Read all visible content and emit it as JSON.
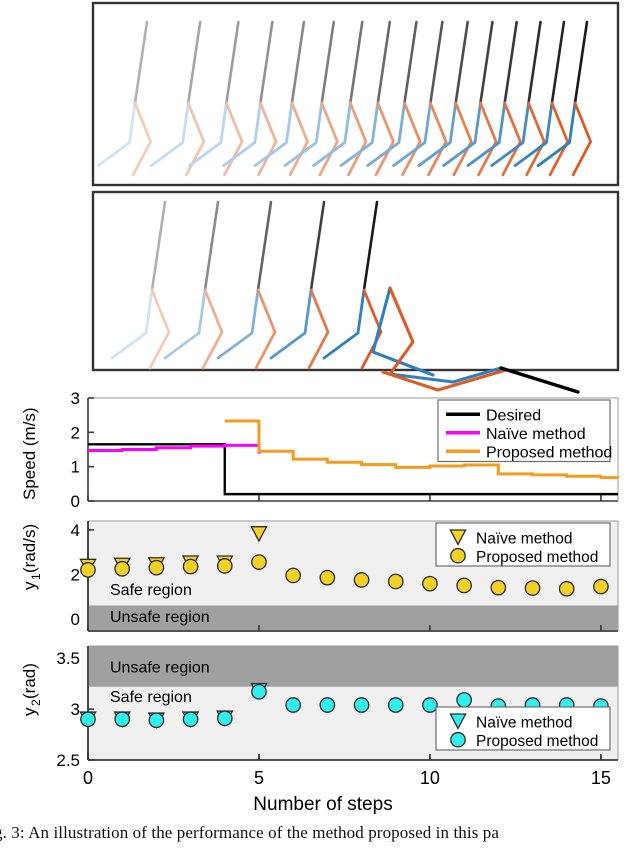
{
  "figure": {
    "caption": "g. 3: An illustration of the performance of the method proposed in this pa",
    "colors": {
      "desired": "#000000",
      "naive": "#ff00ff",
      "proposed": "#f59b1e",
      "y1_marker": "#f2d024",
      "y2_marker": "#2ff0ef",
      "safe_region": "#f0f0f0",
      "unsafe_region": "#a0a0a0",
      "leg_blue": "#2f7fc1",
      "leg_orange": "#de5c22",
      "torso": "#1a1a1a"
    }
  },
  "panels": {
    "top_walk": {
      "name": "Proposed method gait animation",
      "n_figures": 16,
      "outcome": "walks successfully"
    },
    "bottom_walk": {
      "name": "Naive method gait animation",
      "n_figures": 6,
      "outcome": "falls after 5 steps"
    }
  },
  "chart_data": [
    {
      "id": "speed",
      "type": "line",
      "title": "",
      "xlabel": "",
      "ylabel": "Speed (m/s)",
      "xlim": [
        0,
        15.5
      ],
      "ylim": [
        0,
        3
      ],
      "yticks": [
        0,
        1,
        2,
        3
      ],
      "ytick_labels": [
        "0",
        "1",
        "2",
        "3"
      ],
      "xticks": [
        0,
        5,
        10,
        15
      ],
      "grid": false,
      "legend_position": "top-right",
      "legend": [
        "Desired",
        "Naïve method",
        "Proposed method"
      ],
      "series": [
        {
          "name": "Desired",
          "color": "#000000",
          "style": "stairs",
          "x": [
            0,
            1,
            2,
            3,
            4,
            4,
            5,
            6,
            7,
            8,
            9,
            10,
            11,
            12,
            13,
            14,
            15,
            15.5
          ],
          "values": [
            1.65,
            1.65,
            1.65,
            1.65,
            1.65,
            0.2,
            0.2,
            0.2,
            0.2,
            0.2,
            0.2,
            0.2,
            0.2,
            0.2,
            0.2,
            0.2,
            0.2,
            0.2
          ]
        },
        {
          "name": "Naïve method",
          "color": "#ff00ff",
          "style": "stairs",
          "x": [
            0,
            1,
            2,
            3,
            4,
            5
          ],
          "values": [
            1.47,
            1.5,
            1.55,
            1.6,
            1.62,
            1.38
          ]
        },
        {
          "name": "Proposed method",
          "color": "#f59b1e",
          "style": "stairs",
          "x": [
            4,
            5,
            6,
            7,
            8,
            9,
            10,
            11,
            12,
            13,
            14,
            15,
            15.5
          ],
          "values": [
            2.33,
            1.45,
            1.22,
            1.13,
            1.06,
            0.98,
            1.02,
            1.05,
            0.79,
            0.76,
            0.72,
            0.68,
            0.67
          ]
        }
      ]
    },
    {
      "id": "y1",
      "type": "scatter",
      "title": "",
      "xlabel": "",
      "ylabel": "y1 (rad/s)",
      "ylabel_base": "y",
      "ylabel_sub": "1",
      "ylabel_unit": " (rad/s)",
      "xlim": [
        0,
        15.5
      ],
      "ylim": [
        -0.55,
        4.4
      ],
      "yticks": [
        0,
        2,
        4
      ],
      "ytick_labels": [
        "0",
        "2",
        "4"
      ],
      "xticks": [
        0,
        5,
        10,
        15
      ],
      "grid": false,
      "legend_position": "top-right",
      "legend": [
        "Naïve method",
        "Proposed method"
      ],
      "regions": [
        {
          "label": "Safe region",
          "from": 0.6,
          "to": 4.4,
          "color": "#f0f0f0"
        },
        {
          "label": "Unsafe region",
          "from": -0.55,
          "to": 0.6,
          "color": "#a0a0a0"
        }
      ],
      "series": [
        {
          "name": "Naïve method",
          "color": "#f2d024",
          "marker": "triangle-down",
          "x": [
            0,
            1,
            2,
            3,
            4,
            5
          ],
          "values": [
            2.35,
            2.4,
            2.42,
            2.5,
            2.5,
            3.82
          ]
        },
        {
          "name": "Proposed method",
          "color": "#f2d024",
          "marker": "circle",
          "x": [
            0,
            1,
            2,
            3,
            4,
            5,
            6,
            7,
            8,
            9,
            10,
            11,
            12,
            13,
            14,
            15
          ],
          "values": [
            2.2,
            2.25,
            2.3,
            2.35,
            2.38,
            2.55,
            1.95,
            1.85,
            1.75,
            1.68,
            1.58,
            1.5,
            1.4,
            1.38,
            1.35,
            1.45
          ]
        }
      ]
    },
    {
      "id": "y2",
      "type": "scatter",
      "title": "",
      "xlabel": "Number of steps",
      "ylabel": "y2 (rad)",
      "ylabel_base": "y",
      "ylabel_sub": "2",
      "ylabel_unit": " (rad)",
      "xlim": [
        0,
        15.5
      ],
      "ylim": [
        2.5,
        3.62
      ],
      "yticks": [
        2.5,
        3,
        3.5
      ],
      "ytick_labels": [
        "2.5",
        "3",
        "3.5"
      ],
      "xticks": [
        0,
        5,
        10,
        15
      ],
      "xtick_labels": [
        "0",
        "5",
        "10",
        "15"
      ],
      "grid": false,
      "legend_position": "bottom-right",
      "legend": [
        "Naïve method",
        "Proposed method"
      ],
      "regions": [
        {
          "label": "Unsafe region",
          "from": 3.22,
          "to": 3.62,
          "color": "#a0a0a0"
        },
        {
          "label": "Safe region",
          "from": 2.5,
          "to": 3.22,
          "color": "#f0f0f0"
        }
      ],
      "series": [
        {
          "name": "Naïve method",
          "color": "#2ff0ef",
          "marker": "triangle-down",
          "x": [
            0,
            1,
            2,
            3,
            4,
            5
          ],
          "values": [
            2.9,
            2.9,
            2.89,
            2.9,
            2.91,
            3.18
          ]
        },
        {
          "name": "Proposed method",
          "color": "#2ff0ef",
          "marker": "circle",
          "x": [
            0,
            1,
            2,
            3,
            4,
            5,
            6,
            7,
            8,
            9,
            10,
            11,
            12,
            13,
            14,
            15
          ],
          "values": [
            2.9,
            2.9,
            2.89,
            2.9,
            2.91,
            3.17,
            3.04,
            3.04,
            3.04,
            3.04,
            3.04,
            3.09,
            3.03,
            3.04,
            3.04,
            3.03
          ]
        }
      ]
    }
  ]
}
